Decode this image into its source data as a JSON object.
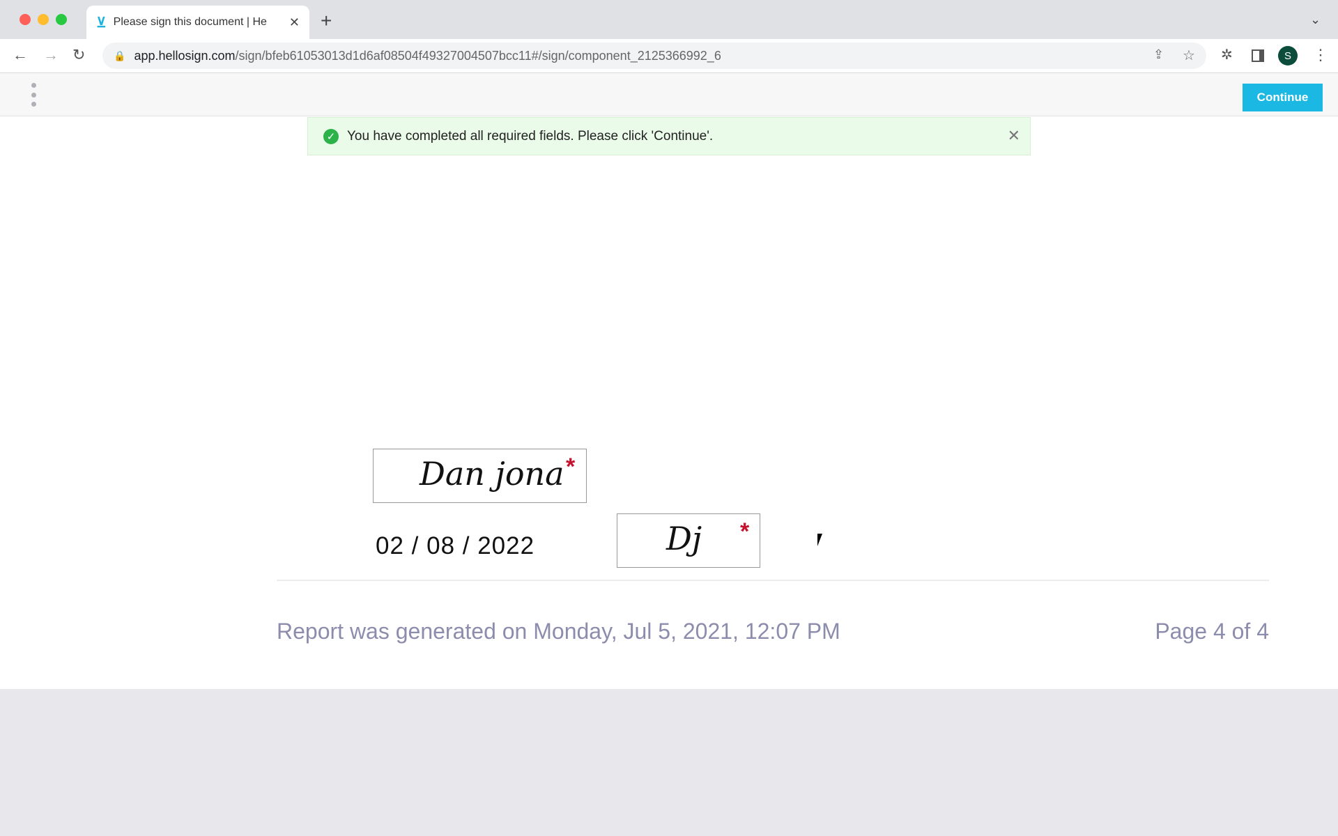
{
  "browser": {
    "tab_title": "Please sign this document | He",
    "url_host": "app.hellosign.com",
    "url_path": "/sign/bfeb61053013d1d6af08504f49327004507bcc11#/sign/component_2125366992_6",
    "profile_initial": "S"
  },
  "header": {
    "continue_label": "Continue",
    "accent": "#1ab8e3"
  },
  "banner": {
    "message": "You have completed all required fields. Please click 'Continue'."
  },
  "document": {
    "signature": "Dan jona",
    "initials": "Dj",
    "date": "02 / 08 / 2022",
    "required_marker": "*",
    "footer_generated": "Report was generated on Monday, Jul 5, 2021, 12:07 PM",
    "footer_page": "Page 4 of 4"
  }
}
